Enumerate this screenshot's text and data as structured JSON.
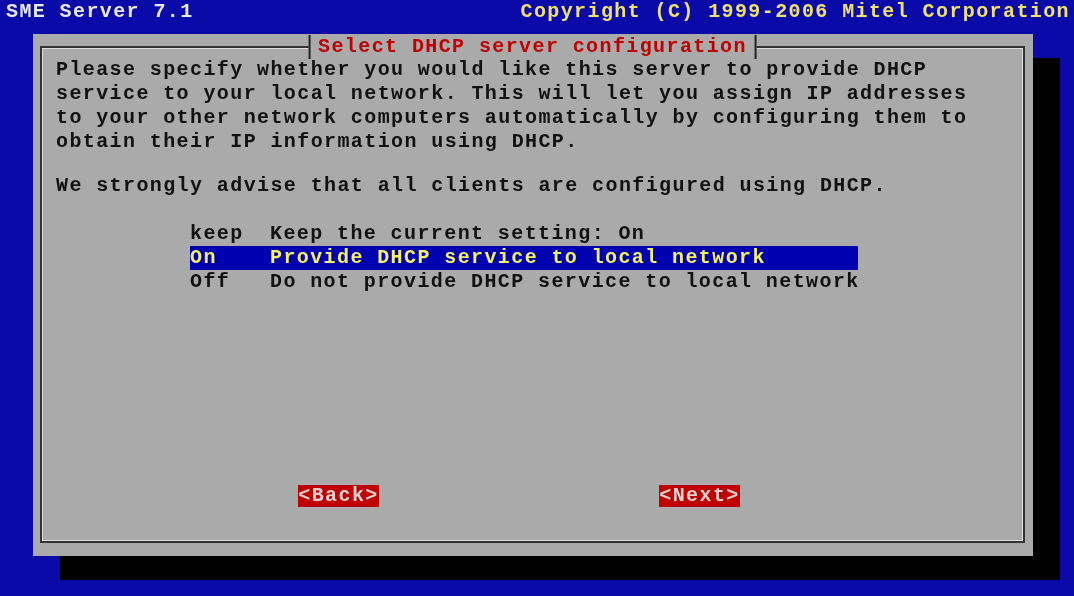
{
  "header": {
    "title": "SME Server 7.1",
    "copyright": "Copyright (C) 1999-2006 Mitel Corporation"
  },
  "dialog": {
    "title": "Select DHCP server configuration",
    "paragraphs": [
      "Please specify whether you would like this server to provide DHCP service to your local network. This will let you assign IP addresses to your other network computers automatically by configuring them to obtain their IP information using DHCP.",
      "We strongly advise that all clients are configured using DHCP."
    ],
    "options": [
      {
        "tag": "keep",
        "label": "Keep the current setting: On",
        "selected": false
      },
      {
        "tag": "On",
        "label": "Provide DHCP service to local network",
        "selected": true
      },
      {
        "tag": "Off",
        "label": "Do not provide DHCP service to local network",
        "selected": false
      }
    ],
    "buttons": [
      "<Back>",
      "<Next>"
    ]
  }
}
